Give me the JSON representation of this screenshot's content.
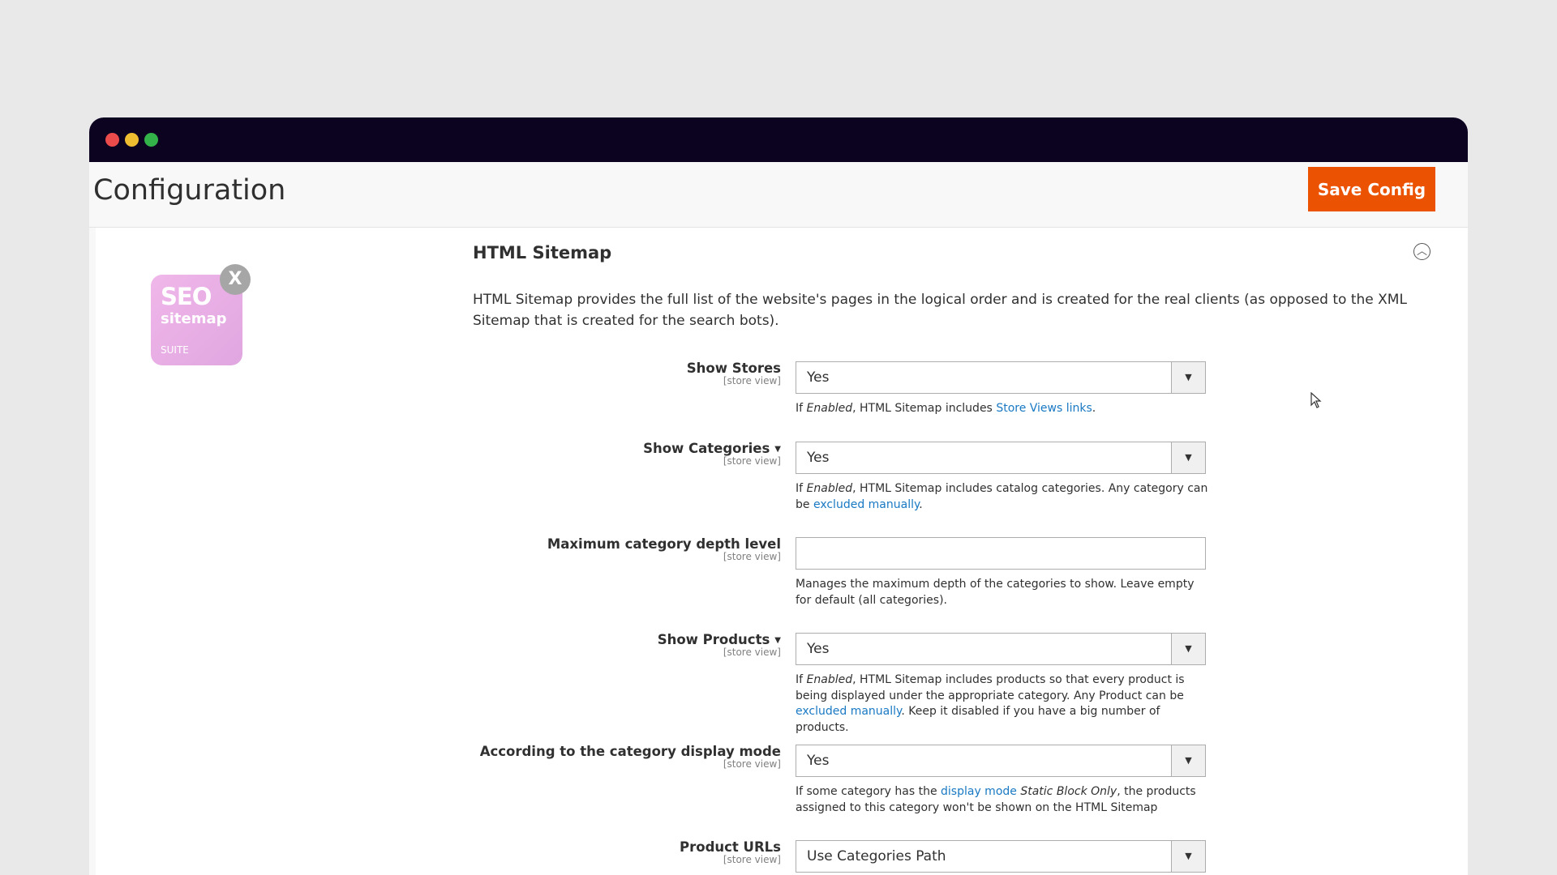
{
  "window": {
    "controls": [
      "close",
      "minimize",
      "maximize"
    ]
  },
  "header": {
    "title": "Configuration",
    "save_label": "Save Config"
  },
  "logo": {
    "line1": "SEO",
    "line2": "sitemap",
    "line3": "SUITE",
    "close": "X"
  },
  "section": {
    "title": "HTML Sitemap",
    "intro": "HTML Sitemap provides the full list of the website's pages in the logical order and is created for the real clients (as opposed to the XML Sitemap that is created for the search bots)."
  },
  "fields": [
    {
      "label": "Show Stores",
      "scope": "[store view]",
      "value": "Yes",
      "note_parts": [
        "If ",
        "Enabled",
        ", HTML Sitemap includes ",
        "Store Views links",
        "."
      ]
    },
    {
      "label": "Show Categories",
      "scope": "[store view]",
      "value": "Yes",
      "note_parts": [
        "If ",
        "Enabled",
        ", HTML Sitemap includes catalog categories. Any category can be ",
        "excluded manually",
        "."
      ]
    },
    {
      "label": "Maximum category depth level",
      "scope": "[store view]",
      "value": "",
      "note": "Manages the maximum depth of the categories to show. Leave empty for default (all categories)."
    },
    {
      "label": "Show Products",
      "scope": "[store view]",
      "value": "Yes",
      "note_parts": [
        "If ",
        "Enabled",
        ", HTML Sitemap includes products so that every product is being displayed under the appropriate category. Any Product can be ",
        "excluded manually",
        ". Keep it disabled if you have a big number of products."
      ]
    },
    {
      "label": "According to the category display mode",
      "scope": "[store view]",
      "value": "Yes",
      "note_parts": [
        "If some category has the ",
        "display mode",
        " ",
        "Static Block Only",
        ", the products assigned to this category won't be shown on the HTML Sitemap"
      ]
    },
    {
      "label": "Product URLs",
      "scope": "[store view]",
      "value": "Use Categories Path"
    }
  ],
  "colors": {
    "accent": "#eb5202",
    "link": "#1979c3",
    "titlebar": "#0c0320"
  }
}
